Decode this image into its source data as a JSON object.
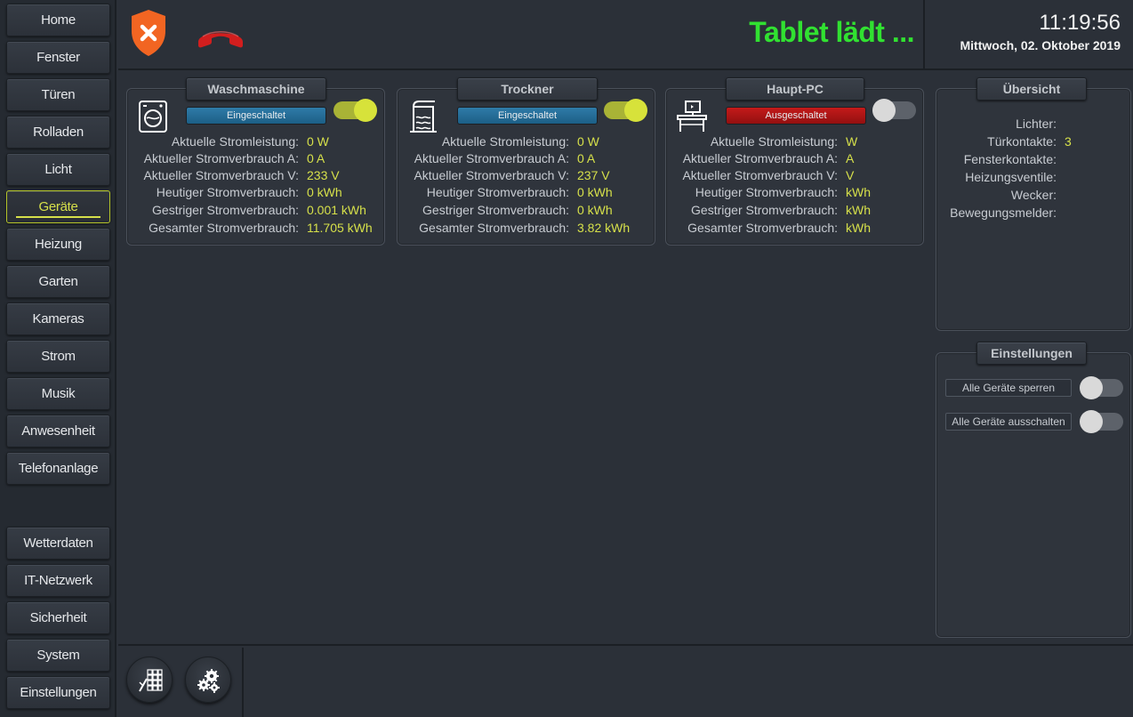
{
  "nav": {
    "items": [
      {
        "label": "Home",
        "active": false
      },
      {
        "label": "Fenster",
        "active": false
      },
      {
        "label": "Türen",
        "active": false
      },
      {
        "label": "Rolladen",
        "active": false
      },
      {
        "label": "Licht",
        "active": false
      },
      {
        "label": "Geräte",
        "active": true
      },
      {
        "label": "Heizung",
        "active": false
      },
      {
        "label": "Garten",
        "active": false
      },
      {
        "label": "Kameras",
        "active": false
      },
      {
        "label": "Strom",
        "active": false
      },
      {
        "label": "Musik",
        "active": false
      },
      {
        "label": "Anwesenheit",
        "active": false
      },
      {
        "label": "Telefonanlage",
        "active": false
      }
    ],
    "bottom_items": [
      {
        "label": "Wetterdaten"
      },
      {
        "label": "IT-Netzwerk"
      },
      {
        "label": "Sicherheit"
      },
      {
        "label": "System"
      },
      {
        "label": "Einstellungen"
      }
    ]
  },
  "header": {
    "security_icon": "shield-x-icon",
    "phone_icon": "phone-hangup-icon",
    "status_text": "Tablet lädt ...",
    "status_color": "#31e131",
    "time": "11:19:56",
    "date": "Mittwoch, 02. Oktober 2019"
  },
  "devices": [
    {
      "name": "Waschmaschine",
      "icon": "washing-machine-icon",
      "state_label": "Eingeschaltet",
      "switch_on": true,
      "metrics": [
        {
          "label": "Aktuelle Stromleistung:",
          "value": "0 W"
        },
        {
          "label": "Aktueller Stromverbrauch A:",
          "value": "0 A"
        },
        {
          "label": "Aktueller Stromverbrauch V:",
          "value": "233 V"
        },
        {
          "label": "Heutiger Stromverbrauch:",
          "value": "0 kWh"
        },
        {
          "label": "Gestriger Stromverbrauch:",
          "value": "0.001 kWh"
        },
        {
          "label": "Gesamter Stromverbrauch:",
          "value": "11.705 kWh"
        }
      ]
    },
    {
      "name": "Trockner",
      "icon": "dryer-icon",
      "state_label": "Eingeschaltet",
      "switch_on": true,
      "metrics": [
        {
          "label": "Aktuelle Stromleistung:",
          "value": "0 W"
        },
        {
          "label": "Aktueller Stromverbrauch A:",
          "value": "0 A"
        },
        {
          "label": "Aktueller Stromverbrauch V:",
          "value": "237 V"
        },
        {
          "label": "Heutiger Stromverbrauch:",
          "value": "0 kWh"
        },
        {
          "label": "Gestriger Stromverbrauch:",
          "value": "0 kWh"
        },
        {
          "label": "Gesamter Stromverbrauch:",
          "value": "3.82 kWh"
        }
      ]
    },
    {
      "name": "Haupt-PC",
      "icon": "desk-computer-icon",
      "state_label": "Ausgeschaltet",
      "switch_on": false,
      "metrics": [
        {
          "label": "Aktuelle Stromleistung:",
          "value": "W"
        },
        {
          "label": "Aktueller Stromverbrauch A:",
          "value": "A"
        },
        {
          "label": "Aktueller Stromverbrauch V:",
          "value": "V"
        },
        {
          "label": "Heutiger Stromverbrauch:",
          "value": "kWh"
        },
        {
          "label": "Gestriger Stromverbrauch:",
          "value": "kWh"
        },
        {
          "label": "Gesamter Stromverbrauch:",
          "value": "kWh"
        }
      ]
    }
  ],
  "overview": {
    "title": "Übersicht",
    "rows": [
      {
        "label": "Lichter:",
        "value": ""
      },
      {
        "label": "Türkontakte:",
        "value": "3"
      },
      {
        "label": "Fensterkontakte:",
        "value": ""
      },
      {
        "label": "Heizungsventile:",
        "value": ""
      },
      {
        "label": "Wecker:",
        "value": ""
      },
      {
        "label": "Bewegungsmelder:",
        "value": ""
      }
    ]
  },
  "settings": {
    "title": "Einstellungen",
    "items": [
      {
        "label": "Alle Geräte sperren",
        "on": false
      },
      {
        "label": "Alle Geräte ausschalten",
        "on": false
      }
    ]
  },
  "bottom": {
    "buttons": [
      {
        "icon": "keypad-icon"
      },
      {
        "icon": "gears-icon"
      }
    ]
  },
  "colors": {
    "accent": "#d6e04a",
    "on_state": "#2f7ba8",
    "off_state": "#c41a1a",
    "alert": "#f26522"
  }
}
